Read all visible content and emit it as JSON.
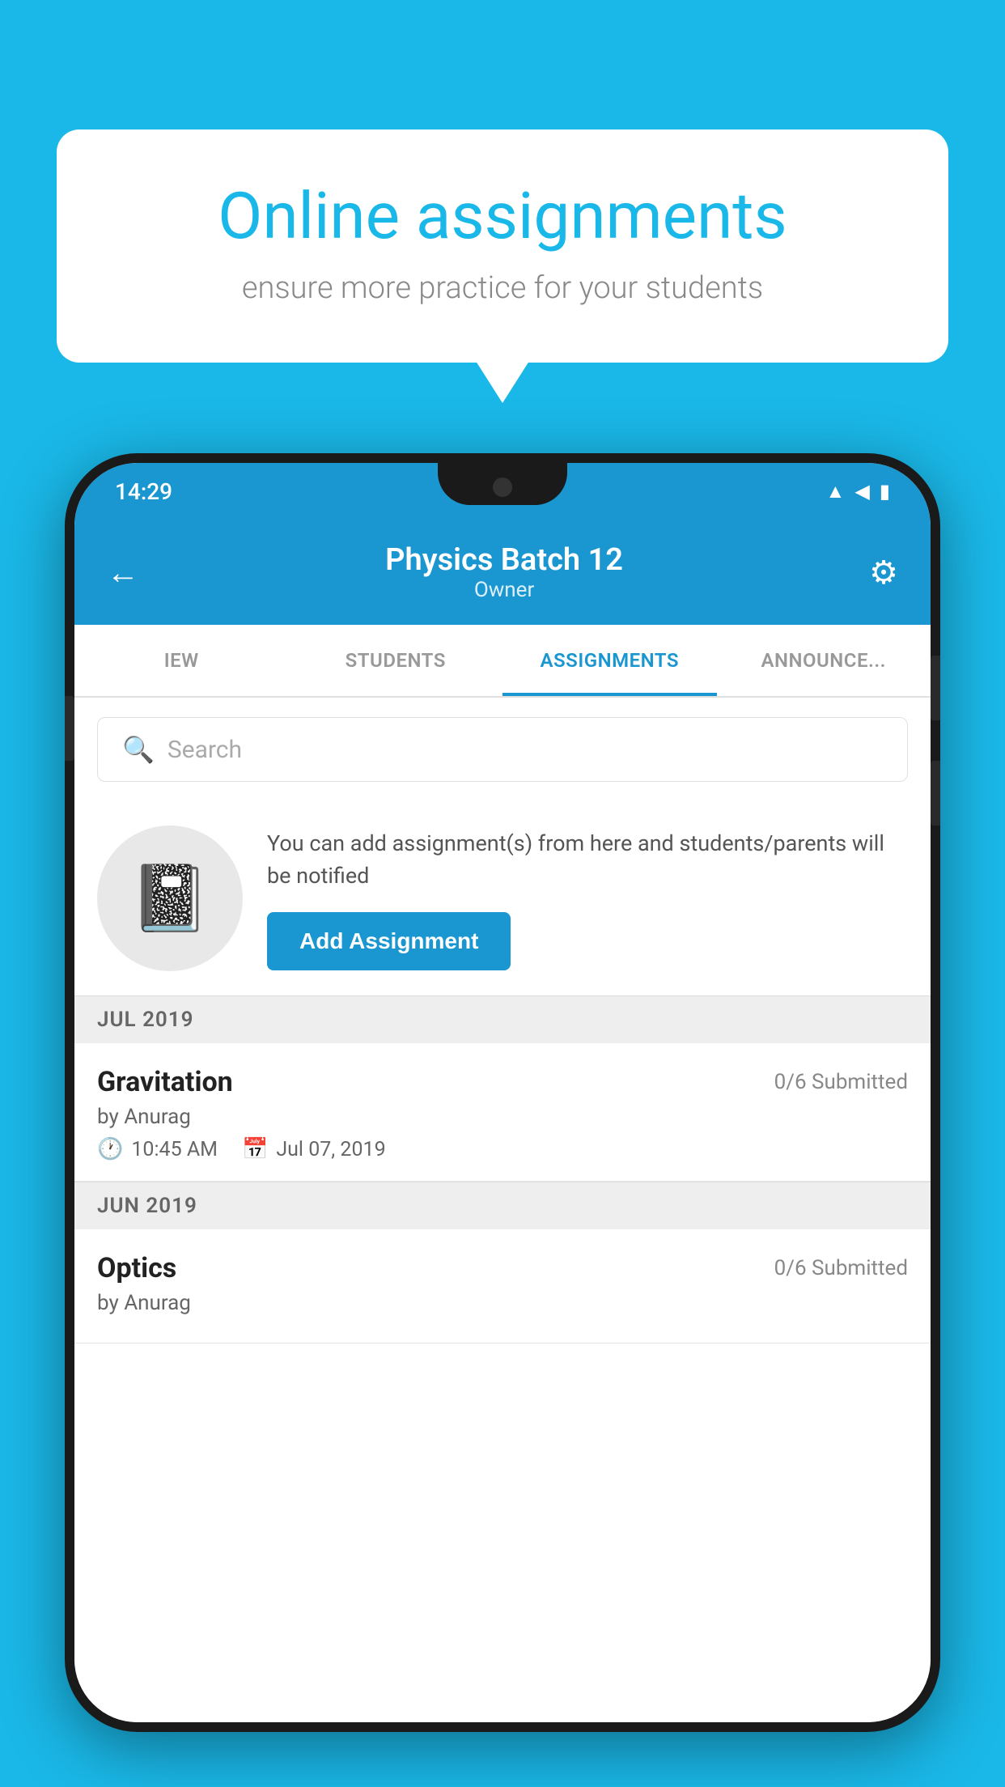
{
  "background_color": "#1ab8e8",
  "speech_bubble": {
    "title": "Online assignments",
    "subtitle": "ensure more practice for your students"
  },
  "status_bar": {
    "time": "14:29",
    "icons": [
      "wifi",
      "signal",
      "battery"
    ]
  },
  "app_header": {
    "title": "Physics Batch 12",
    "subtitle": "Owner",
    "back_label": "←",
    "settings_label": "⚙"
  },
  "tabs": [
    {
      "id": "iew",
      "label": "IEW",
      "active": false
    },
    {
      "id": "students",
      "label": "STUDENTS",
      "active": false
    },
    {
      "id": "assignments",
      "label": "ASSIGNMENTS",
      "active": true
    },
    {
      "id": "announcements",
      "label": "ANNOUNCEMENTS",
      "active": false
    }
  ],
  "search": {
    "placeholder": "Search"
  },
  "promo": {
    "description": "You can add assignment(s) from here and students/parents will be notified",
    "button_label": "Add Assignment"
  },
  "sections": [
    {
      "label": "JUL 2019",
      "assignments": [
        {
          "name": "Gravitation",
          "submitted": "0/6 Submitted",
          "author": "by Anurag",
          "time": "10:45 AM",
          "date": "Jul 07, 2019"
        }
      ]
    },
    {
      "label": "JUN 2019",
      "assignments": [
        {
          "name": "Optics",
          "submitted": "0/6 Submitted",
          "author": "by Anurag",
          "time": "",
          "date": ""
        }
      ]
    }
  ]
}
